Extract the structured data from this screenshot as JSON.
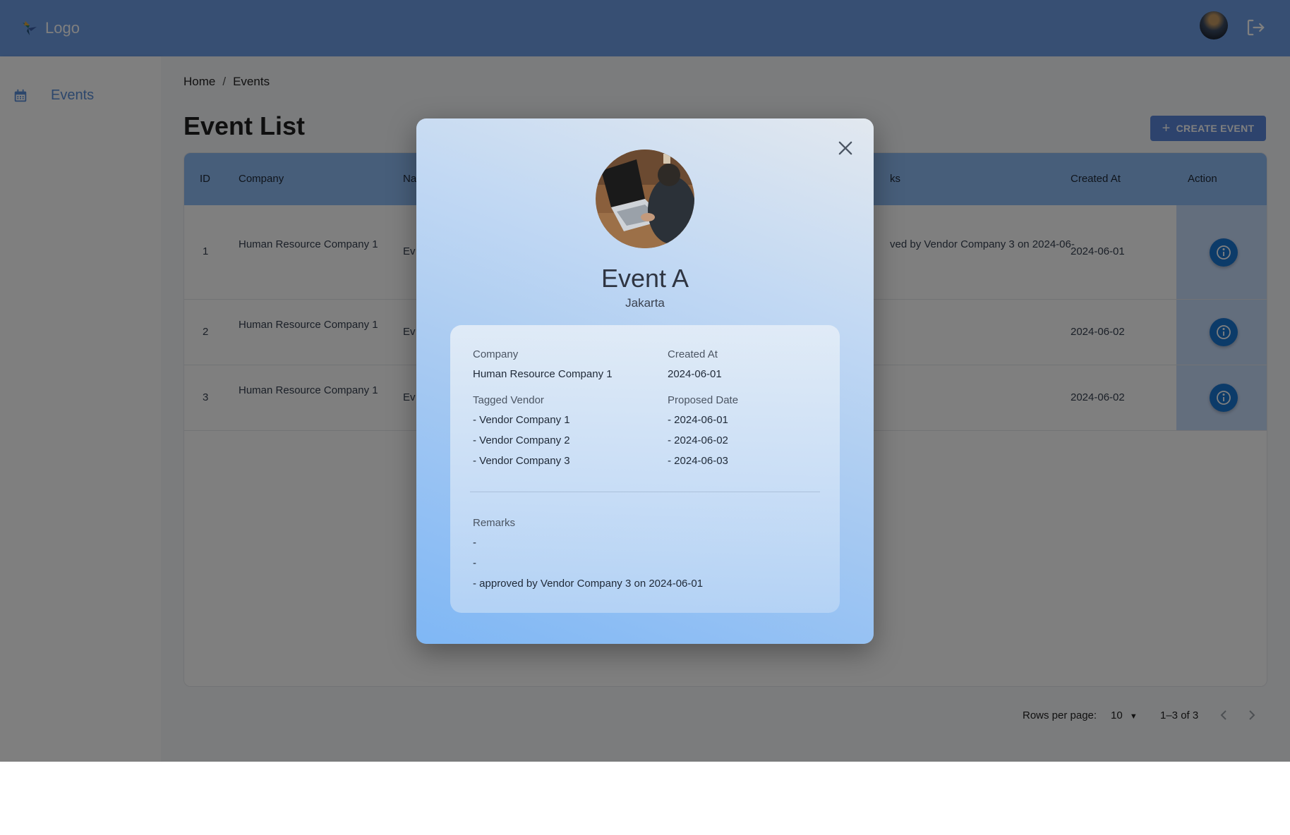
{
  "header": {
    "logo_text": "Logo",
    "avatar_alt": "user avatar",
    "logout_icon": "logout-icon"
  },
  "sidebar": {
    "items": [
      {
        "label": "Events",
        "icon": "calendar-icon"
      }
    ]
  },
  "breadcrumb": {
    "items": [
      "Home",
      "Events"
    ],
    "separator": "/"
  },
  "page": {
    "title": "Event List",
    "create_button_label": "CREATE EVENT"
  },
  "table": {
    "columns": [
      "ID",
      "Company",
      "Na",
      "ks",
      "Created At",
      "Action"
    ],
    "rows": [
      {
        "id": "1",
        "company": "Human Resource Company 1",
        "name": "Ev",
        "remarks": "ved by Vendor Company 3 on 2024-06-",
        "created_at": "2024-06-01"
      },
      {
        "id": "2",
        "company": "Human Resource Company 1",
        "name": "Ev",
        "remarks": "",
        "created_at": "2024-06-02"
      },
      {
        "id": "3",
        "company": "Human Resource Company 1",
        "name": "Ev",
        "remarks": "",
        "created_at": "2024-06-02"
      }
    ]
  },
  "pagination": {
    "rows_per_page_label": "Rows per page:",
    "rows_per_page_value": "10",
    "range_label": "1–3 of 3"
  },
  "modal": {
    "title": "Event A",
    "location": "Jakarta",
    "company_label": "Company",
    "company_value": "Human Resource Company 1",
    "created_at_label": "Created At",
    "created_at_value": "2024-06-01",
    "tagged_vendor_label": "Tagged Vendor",
    "vendors": [
      "- Vendor Company 1",
      "- Vendor Company 2",
      "- Vendor Company 3"
    ],
    "proposed_date_label": "Proposed Date",
    "proposed_dates": [
      "- 2024-06-01",
      "- 2024-06-02",
      "- 2024-06-03"
    ],
    "remarks_label": "Remarks",
    "remarks": [
      "-",
      "-",
      "- approved by Vendor Company 3 on 2024-06-01"
    ]
  },
  "colors": {
    "topbar": "#6f9fe6",
    "accent": "#5a87db",
    "info_button": "#1976d2",
    "overlay": "rgba(0,0,0,0.5)"
  }
}
